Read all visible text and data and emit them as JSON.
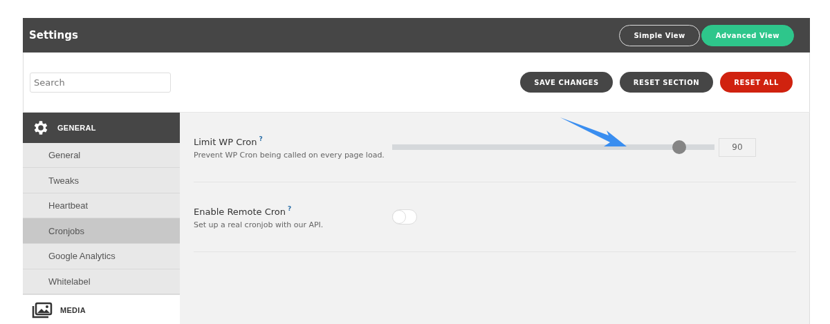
{
  "header": {
    "title": "Settings",
    "views": [
      {
        "label": "Simple View",
        "selected": false
      },
      {
        "label": "Advanced View",
        "selected": true
      }
    ]
  },
  "search": {
    "placeholder": "Search"
  },
  "actions": [
    {
      "label": "SAVE CHANGES",
      "kind": "normal"
    },
    {
      "label": "RESET SECTION",
      "kind": "normal"
    },
    {
      "label": "RESET ALL",
      "kind": "danger"
    }
  ],
  "sidebar": {
    "sections": [
      {
        "label": "GENERAL",
        "expanded": true,
        "items": [
          {
            "label": "General",
            "selected": false
          },
          {
            "label": "Tweaks",
            "selected": false
          },
          {
            "label": "Heartbeat",
            "selected": false
          },
          {
            "label": "Cronjobs",
            "selected": true
          },
          {
            "label": "Google Analytics",
            "selected": false
          },
          {
            "label": "Whitelabel",
            "selected": false
          }
        ]
      },
      {
        "label": "MEDIA",
        "expanded": false
      }
    ]
  },
  "settings": [
    {
      "kind": "slider",
      "title": "Limit WP Cron",
      "help": "?",
      "description": "Prevent WP Cron being called on every page load.",
      "level": 0.89,
      "value": "90"
    },
    {
      "kind": "toggle",
      "title": "Enable Remote Cron",
      "help": "?",
      "description": "Set up a real cronjob with our API.",
      "on": false
    }
  ]
}
